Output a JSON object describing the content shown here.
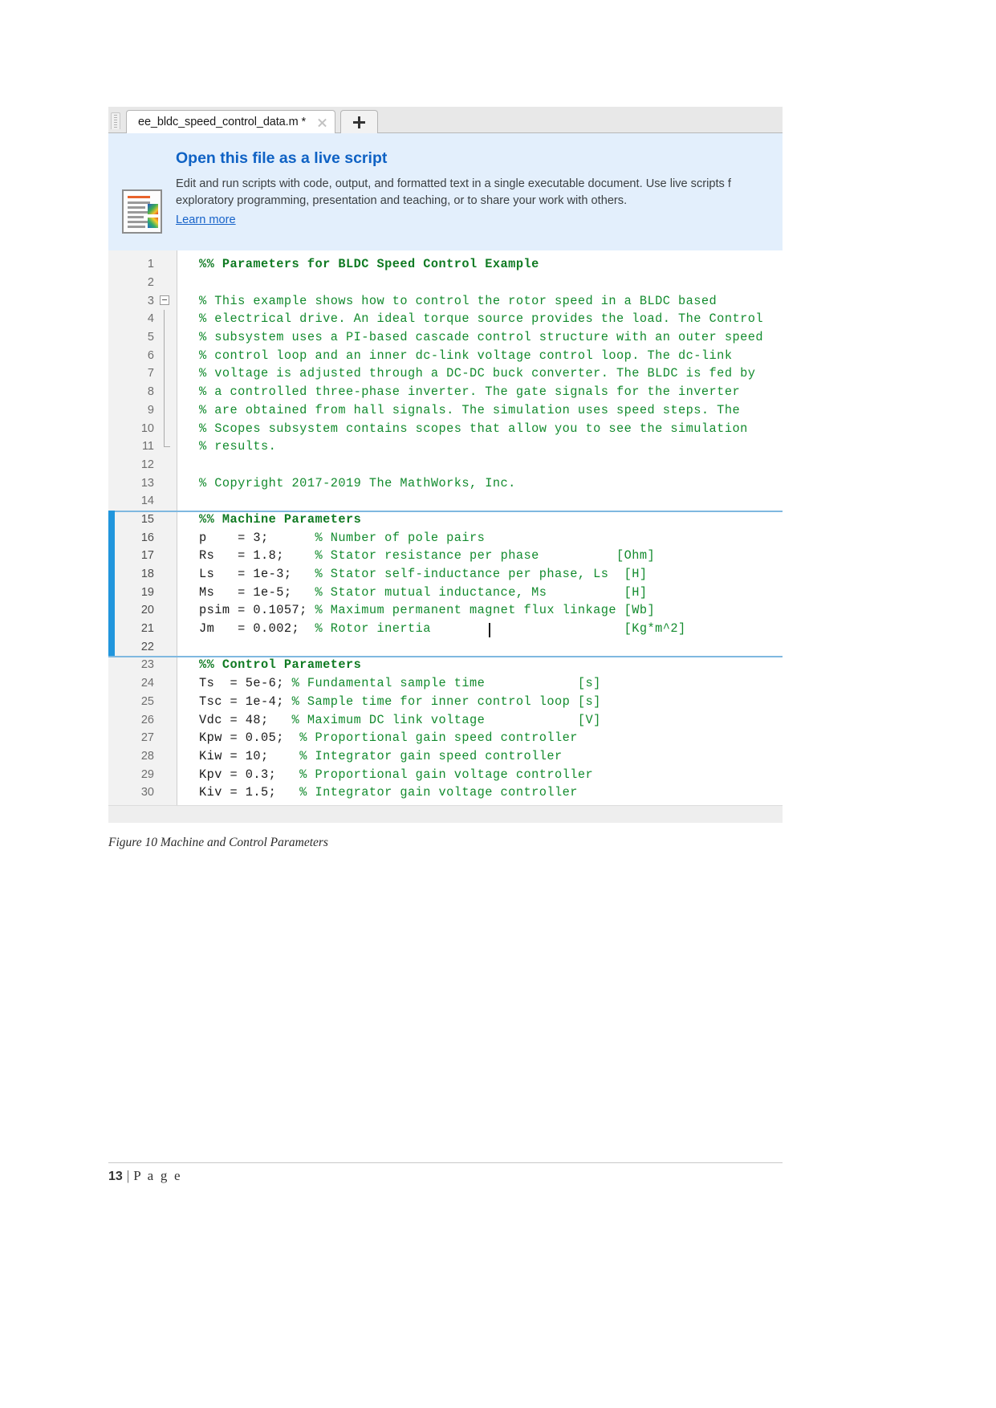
{
  "document": {
    "caption": "Figure 10 Machine and Control Parameters",
    "footer": {
      "page_number": "13",
      "separator": "|",
      "page_word": "P a g e"
    }
  },
  "editor_window": {
    "tab": {
      "title": "ee_bldc_speed_control_data.m *",
      "close_icon": "close-icon",
      "new_tab_icon": "plus-icon"
    },
    "banner": {
      "title": "Open this file as a live script",
      "body_line_1": "Edit and run scripts with code, output, and formatted text in a single executable document. Use live scripts f",
      "body_line_2": "exploratory programming, presentation and teaching, or to share your work with others.",
      "link": "Learn more",
      "icon": "live-script-icon"
    },
    "code": {
      "lines": [
        {
          "n": "1",
          "text": "%% Parameters for BLDC Speed Control Example",
          "style": "section"
        },
        {
          "n": "2",
          "text": "",
          "style": "plain"
        },
        {
          "n": "3",
          "text": "% This example shows how to control the rotor speed in a BLDC based",
          "style": "comment"
        },
        {
          "n": "4",
          "text": "% electrical drive. An ideal torque source provides the load. The Control",
          "style": "comment"
        },
        {
          "n": "5",
          "text": "% subsystem uses a PI-based cascade control structure with an outer speed",
          "style": "comment"
        },
        {
          "n": "6",
          "text": "% control loop and an inner dc-link voltage control loop. The dc-link",
          "style": "comment"
        },
        {
          "n": "7",
          "text": "% voltage is adjusted through a DC-DC buck converter. The BLDC is fed by",
          "style": "comment"
        },
        {
          "n": "8",
          "text": "% a controlled three-phase inverter. The gate signals for the inverter",
          "style": "comment"
        },
        {
          "n": "9",
          "text": "% are obtained from hall signals. The simulation uses speed steps. The",
          "style": "comment"
        },
        {
          "n": "10",
          "text": "% Scopes subsystem contains scopes that allow you to see the simulation",
          "style": "comment"
        },
        {
          "n": "11",
          "text": "% results.",
          "style": "comment"
        },
        {
          "n": "12",
          "text": "",
          "style": "plain"
        },
        {
          "n": "13",
          "text": "% Copyright 2017-2019 The MathWorks, Inc.",
          "style": "comment"
        },
        {
          "n": "14",
          "text": "",
          "style": "plain"
        },
        {
          "n": "15",
          "text": "%% Machine Parameters",
          "style": "section"
        },
        {
          "n": "16",
          "code": "p    = 3;",
          "comment": "      % Number of pole pairs"
        },
        {
          "n": "17",
          "code": "Rs   = 1.8;",
          "comment": "    % Stator resistance per phase          [Ohm]"
        },
        {
          "n": "18",
          "code": "Ls   = 1e-3;",
          "comment": "   % Stator self-inductance per phase, Ls  [H]"
        },
        {
          "n": "19",
          "code": "Ms   = 1e-5;",
          "comment": "   % Stator mutual inductance, Ms          [H]"
        },
        {
          "n": "20",
          "code": "psim = 0.1057;",
          "comment": " % Maximum permanent magnet flux linkage [Wb]"
        },
        {
          "n": "21",
          "code": "Jm   = 0.002;",
          "comment": "  % Rotor inertia                         [Kg*m^2]"
        },
        {
          "n": "22",
          "text": "",
          "style": "plain"
        },
        {
          "n": "23",
          "text": "%% Control Parameters",
          "style": "section"
        },
        {
          "n": "24",
          "code": "Ts  = 5e-6;",
          "comment": " % Fundamental sample time            [s]"
        },
        {
          "n": "25",
          "code": "Tsc = 1e-4;",
          "comment": " % Sample time for inner control loop [s]"
        },
        {
          "n": "26",
          "code": "Vdc = 48;",
          "comment": "   % Maximum DC link voltage            [V]"
        },
        {
          "n": "27",
          "code": "Kpw = 0.05;",
          "comment": "  % Proportional gain speed controller"
        },
        {
          "n": "28",
          "code": "Kiw = 10;",
          "comment": "    % Integrator gain speed controller"
        },
        {
          "n": "29",
          "code": "Kpv = 0.3;",
          "comment": "   % Proportional gain voltage controller"
        },
        {
          "n": "30",
          "code": "Kiv = 1.5;",
          "comment": "   % Integrator gain voltage controller"
        }
      ],
      "active_section_lines": [
        "15",
        "16",
        "17",
        "18",
        "19",
        "20",
        "21",
        "22"
      ]
    },
    "colors": {
      "banner_background": "#e3effc",
      "banner_title": "#0f62c4",
      "link": "#1763c9",
      "comment_green": "#138b2e",
      "section_green": "#0f7a22",
      "active_marker_blue": "#2196dd",
      "section_divider_blue": "#7fb8e0"
    }
  }
}
